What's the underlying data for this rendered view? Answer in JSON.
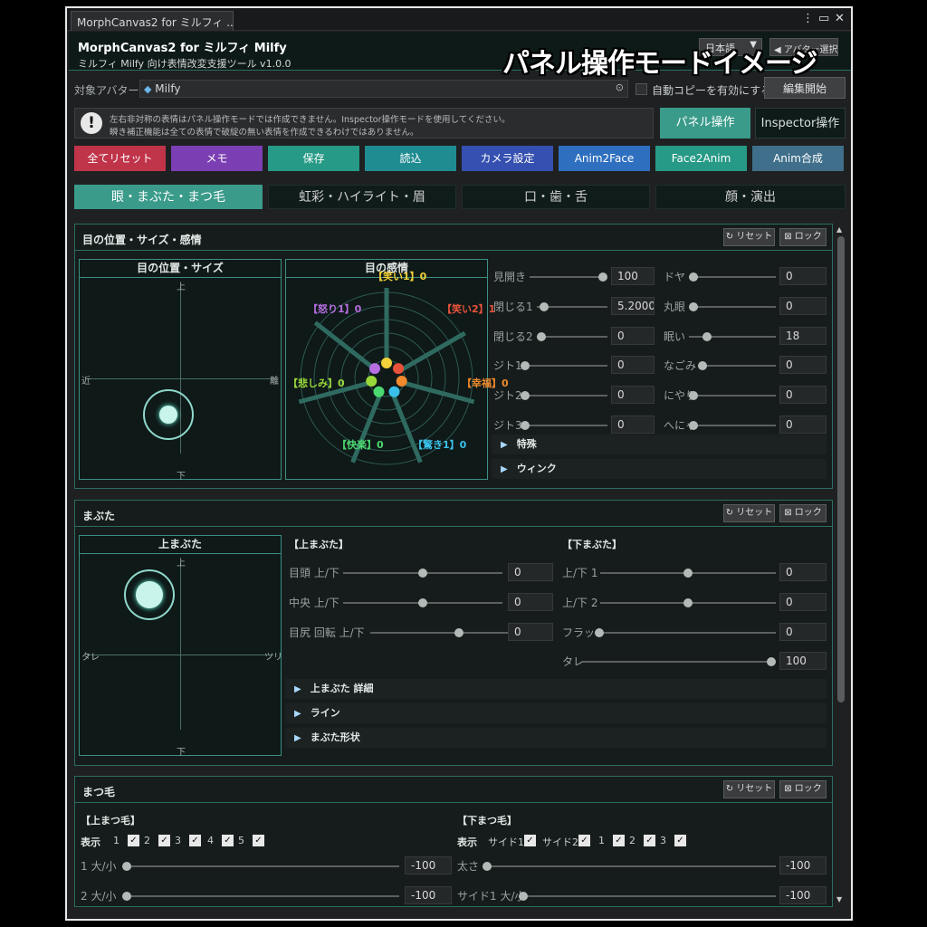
{
  "window": {
    "tab_title": "MorphCanvas2 for ミルフィ ...",
    "title": "MorphCanvas2 for ミルフィ Milfy",
    "subtitle": "ミルフィ Milfy 向け表情改変支援ツール v1.0.0",
    "language": "日本語",
    "avatar_select": "◀ アバター選択",
    "overlay_caption": "パネル操作モードイメージ",
    "menu_glyph": "⋮",
    "maximize_glyph": "▭",
    "close_glyph": "✕"
  },
  "target": {
    "label": "対象アバター",
    "avatar_name": "Milfy",
    "auto_copy_label": "自動コピーを有効にする",
    "edit_start": "編集開始"
  },
  "warning": {
    "line1": "左右非対称の表情はパネル操作モードでは作成できません。Inspector操作モードを使用してください。",
    "line2": "瞬き補正機能は全ての表情で破綻の無い表情を作成できるわけではありません。"
  },
  "modes": {
    "panel": "パネル操作",
    "inspector": "Inspector操作"
  },
  "toolbar": [
    {
      "label": "全てリセット",
      "color": "#c0344a"
    },
    {
      "label": "メモ",
      "color": "#7b3fb3"
    },
    {
      "label": "保存",
      "color": "#269a86"
    },
    {
      "label": "読込",
      "color": "#1f8c92"
    },
    {
      "label": "カメラ設定",
      "color": "#3550b0"
    },
    {
      "label": "Anim2Face",
      "color": "#2f6fbf"
    },
    {
      "label": "Face2Anim",
      "color": "#269a86"
    },
    {
      "label": "Anim合成",
      "color": "#3f6f8a"
    }
  ],
  "categories": [
    "眼・まぶた・まつ毛",
    "虹彩・ハイライト・眉",
    "口・歯・舌",
    "顔・演出"
  ],
  "common": {
    "reset": "リセット",
    "lock": "ロック",
    "reset_icon": "↻",
    "lock_icon": "⊠",
    "fold_icon": "▶",
    "check": "✓"
  },
  "eye_panel": {
    "title": "目の位置・サイズ・感情",
    "pos_box": {
      "title": "目の位置・サイズ",
      "top": "上",
      "bottom": "下",
      "left": "近",
      "right": "離"
    },
    "emo_box": {
      "title": "目の感情",
      "labels": [
        {
          "text": "【笑い1】0",
          "color": "#f2d13a"
        },
        {
          "text": "【笑い2】1",
          "color": "#e8523a"
        },
        {
          "text": "【怒り1】0",
          "color": "#b46ee0"
        },
        {
          "text": "【幸福】0",
          "color": "#f08a2c"
        },
        {
          "text": "【悲しみ】0",
          "color": "#9ad83a"
        },
        {
          "text": "【快楽】0",
          "color": "#4cd870"
        },
        {
          "text": "【驚き1】0",
          "color": "#3ac0e8"
        }
      ]
    },
    "sliders_left": [
      {
        "label": "見開き",
        "value": "100",
        "pos": 1.0
      },
      {
        "label": "閉じる1",
        "value": "5.20000",
        "pos": 0.05
      },
      {
        "label": "閉じる2",
        "value": "0",
        "pos": 0.0
      },
      {
        "label": "ジト1",
        "value": "0",
        "pos": 0.0
      },
      {
        "label": "ジト2",
        "value": "0",
        "pos": 0.0
      },
      {
        "label": "ジト3",
        "value": "0",
        "pos": 0.0
      }
    ],
    "sliders_right": [
      {
        "label": "ドヤ",
        "value": "0",
        "pos": 0.0
      },
      {
        "label": "丸眼",
        "value": "0",
        "pos": 0.0
      },
      {
        "label": "眠い",
        "value": "18",
        "pos": 0.18
      },
      {
        "label": "なごみ",
        "value": "0",
        "pos": 0.0
      },
      {
        "label": "にやり",
        "value": "0",
        "pos": 0.0
      },
      {
        "label": "へにゃ",
        "value": "0",
        "pos": 0.0
      }
    ],
    "folds": [
      "特殊",
      "ウィンク"
    ]
  },
  "lid_panel": {
    "title": "まぶた",
    "box": {
      "title": "上まぶた",
      "top": "上",
      "bottom": "下",
      "left": "タレ",
      "right": "ツリ"
    },
    "upper_head": "【上まぶた】",
    "lower_head": "【下まぶた】",
    "upper": [
      {
        "label": "目頭 上/下",
        "value": "0",
        "pos": 0.5
      },
      {
        "label": "中央 上/下",
        "value": "0",
        "pos": 0.5
      },
      {
        "label": "目尻 回転 上/下",
        "value": "0",
        "pos": 0.5
      }
    ],
    "lower": [
      {
        "label": "上/下 1",
        "value": "0",
        "pos": 0.5
      },
      {
        "label": "上/下 2",
        "value": "0",
        "pos": 0.5
      },
      {
        "label": "フラット",
        "value": "0",
        "pos": 0.0
      },
      {
        "label": "タレ",
        "value": "100",
        "pos": 1.0
      }
    ],
    "folds": [
      "上まぶた 詳細",
      "ライン",
      "まぶた形状"
    ]
  },
  "lash_panel": {
    "title": "まつ毛",
    "upper_head": "【上まつ毛】",
    "lower_head": "【下まつ毛】",
    "show": "表示",
    "upper_checks": [
      "1",
      "2",
      "3",
      "4",
      "5"
    ],
    "lower_checks": [
      "サイド1",
      "サイド2",
      "1",
      "2",
      "3"
    ],
    "upper_sliders": [
      {
        "label": "1 大/小",
        "value": "-100",
        "pos": 0.0
      },
      {
        "label": "2 大/小",
        "value": "-100",
        "pos": 0.0
      }
    ],
    "lower_sliders": [
      {
        "label": "太さ",
        "value": "-100",
        "pos": 0.0
      },
      {
        "label": "サイド1 大/小",
        "value": "-100",
        "pos": 0.0
      }
    ]
  }
}
